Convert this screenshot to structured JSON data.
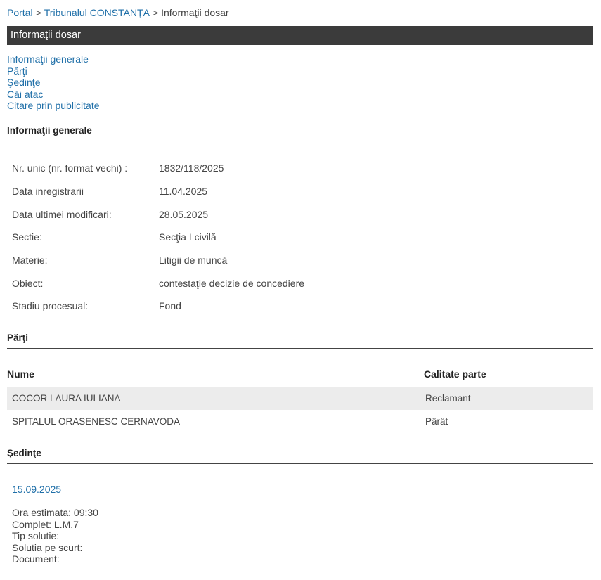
{
  "breadcrumb": {
    "portal": "Portal",
    "court": "Tribunalul CONSTANŢA",
    "current": "Informaţii dosar"
  },
  "title": "Informaţii dosar",
  "toc": [
    "Informaţii generale",
    "Părţi",
    "Şedinţe",
    "Căi atac",
    "Citare prin publicitate"
  ],
  "sections": {
    "general": "Informaţii generale",
    "parties": "Părţi",
    "hearings": "Şedinţe"
  },
  "general_info": [
    {
      "label": "Nr. unic (nr. format vechi) :",
      "value": "1832/118/2025"
    },
    {
      "label": "Data inregistrarii",
      "value": "11.04.2025"
    },
    {
      "label": "Data ultimei modificari:",
      "value": "28.05.2025"
    },
    {
      "label": "Sectie:",
      "value": "Secţia I civilă"
    },
    {
      "label": "Materie:",
      "value": "Litigii de muncă"
    },
    {
      "label": "Obiect:",
      "value": "contestaţie decizie de concediere"
    },
    {
      "label": "Stadiu procesual:",
      "value": "Fond"
    }
  ],
  "parties_table": {
    "headers": {
      "name": "Nume",
      "role": "Calitate parte"
    },
    "rows": [
      {
        "name": "COCOR LAURA IULIANA",
        "role": "Reclamant"
      },
      {
        "name": "SPITALUL ORASENESC CERNAVODA",
        "role": "Pârât"
      }
    ]
  },
  "hearing": {
    "date": "15.09.2025",
    "lines": [
      "Ora estimata: 09:30",
      "Complet: L.M.7",
      "Tip solutie:",
      "Solutia pe scurt:",
      "Document:"
    ]
  }
}
